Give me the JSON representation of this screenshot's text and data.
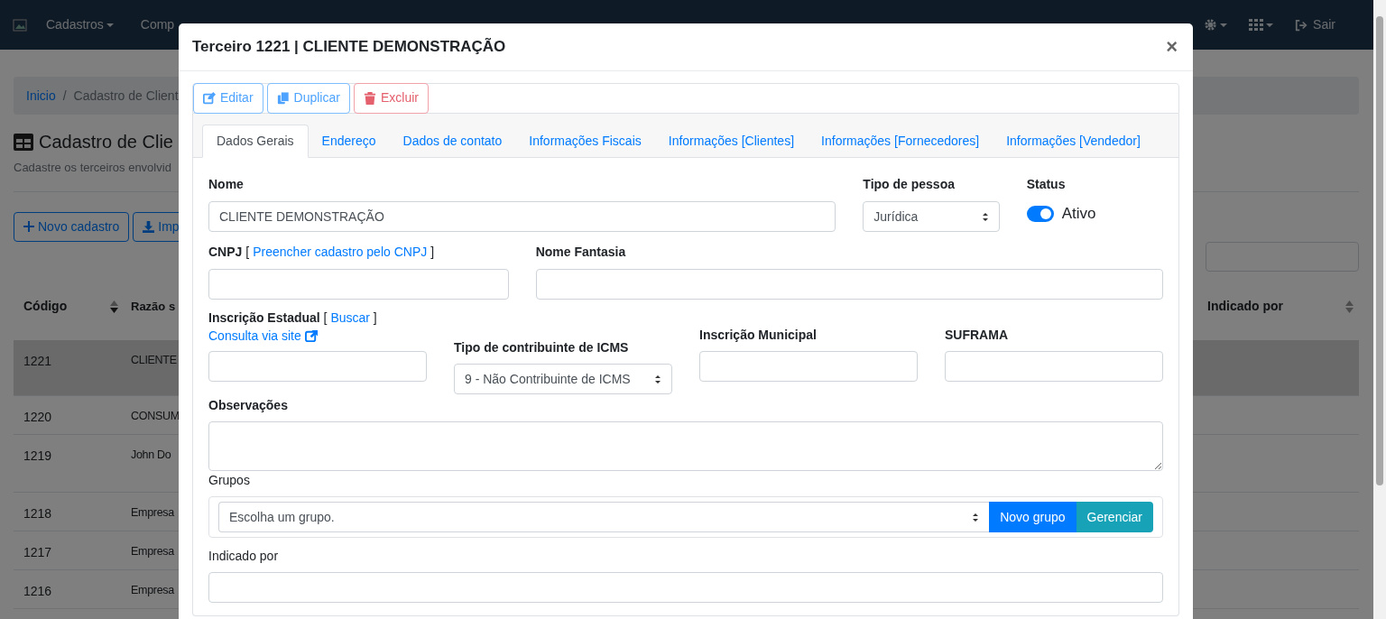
{
  "navbar": {
    "items": [
      {
        "label": "Cadastros",
        "caret": true
      },
      {
        "label": "Comp",
        "caret": false
      }
    ],
    "logout": "Sair"
  },
  "background": {
    "breadcrumb_separator": "/",
    "breadcrumb": [
      {
        "label": "Inicio",
        "link": true
      },
      {
        "label": "Cadastro de Client",
        "link": false
      }
    ],
    "title": "Cadastro de Clie",
    "subtitle": "Cadastre os terceiros envolvid",
    "buttons": [
      "Novo cadastro",
      "Imp"
    ],
    "table": {
      "columns": [
        "Código",
        "Razão s",
        "Indicado por"
      ],
      "rows": [
        {
          "code": "1221",
          "name": "CLIENTE",
          "selected": true
        },
        {
          "code": "1220",
          "name": "CONSUM",
          "selected": false
        },
        {
          "code": "1219",
          "name": "John Do",
          "selected": false
        },
        {
          "code": "1218",
          "name": "Empresa",
          "selected": false
        },
        {
          "code": "1217",
          "name": "Empresa",
          "selected": false
        },
        {
          "code": "1216",
          "name": "Empresa",
          "selected": false
        }
      ]
    }
  },
  "modal": {
    "title": "Terceiro 1221 | CLIENTE DEMONSTRAÇÃO",
    "close": "×",
    "toolbar": [
      {
        "label": "Editar",
        "kind": "edit"
      },
      {
        "label": "Duplicar",
        "kind": "copy"
      },
      {
        "label": "Excluir",
        "kind": "delete"
      }
    ],
    "tabs": [
      {
        "label": "Dados Gerais",
        "selected": true
      },
      {
        "label": "Endereço",
        "selected": false
      },
      {
        "label": "Dados de contato",
        "selected": false
      },
      {
        "label": "Informações Fiscais",
        "selected": false
      },
      {
        "label": "Informações [Clientes]",
        "selected": false
      },
      {
        "label": "Informações [Fornecedores]",
        "selected": false
      },
      {
        "label": "Informações [Vendedor]",
        "selected": false
      }
    ],
    "form": {
      "nome": {
        "label": "Nome",
        "value": "CLIENTE DEMONSTRAÇÃO"
      },
      "tipo_pessoa": {
        "label": "Tipo de pessoa",
        "value": "Jurídica"
      },
      "status": {
        "label": "Status",
        "on": true,
        "text": "Ativo"
      },
      "cnpj": {
        "label": "CNPJ",
        "bracket_open": "[",
        "link": "Preencher cadastro pelo CNPJ",
        "bracket_close": "]"
      },
      "nome_fantasia": {
        "label": "Nome Fantasia"
      },
      "inscricao_estadual": {
        "label": "Inscrição Estadual",
        "bracket_open": "[",
        "link_1": "Buscar",
        "bracket_close": "]",
        "link_2": "Consulta via site"
      },
      "tipo_contribuinte": {
        "label": "Tipo de contribuinte de ICMS",
        "value": "9 - Não Contribuinte de ICMS"
      },
      "inscricao_municipal": {
        "label": "Inscrição Municipal"
      },
      "suframa": {
        "label": "SUFRAMA"
      },
      "observacoes": {
        "label": "Observações"
      },
      "grupos": {
        "label": "Grupos",
        "value": "Escolha um grupo.",
        "buttons": [
          "Novo grupo",
          "Gerenciar"
        ]
      },
      "indicado_por": {
        "label": "Indicado por"
      }
    }
  }
}
